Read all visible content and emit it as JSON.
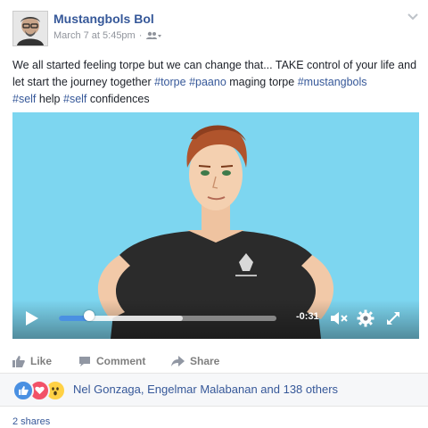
{
  "post": {
    "author": "Mustangbols Bol",
    "date": "March 7 at 5:45pm",
    "meta_sep": "·",
    "body_prefix": "We all started feeling torpe but we can change that... TAKE control of your life and let start the journey together ",
    "tag1": "#torpe",
    "tag2": "#paano",
    "mid_text": " maging torpe ",
    "tag3": "#mustangbols",
    "tag4": "#self",
    "after_tag4": " help ",
    "tag5": "#self",
    "after_tag5": " confidences"
  },
  "video": {
    "time_remaining": "-0:31",
    "progress": 0.14,
    "buffered": 0.57
  },
  "actions": {
    "like": "Like",
    "comment": "Comment",
    "share": "Share"
  },
  "reactions": {
    "icons": [
      "like-icon",
      "love-icon",
      "wow-icon"
    ],
    "text": "Nel Gonzaga, Engelmar Malabanan and 138 others"
  },
  "shares": "2 shares",
  "colors": {
    "link": "#365899",
    "video_bg": "#7dd6f0",
    "like_blue": "#4a90e2",
    "love_red": "#f25268",
    "wow_yellow": "#ffd145"
  }
}
